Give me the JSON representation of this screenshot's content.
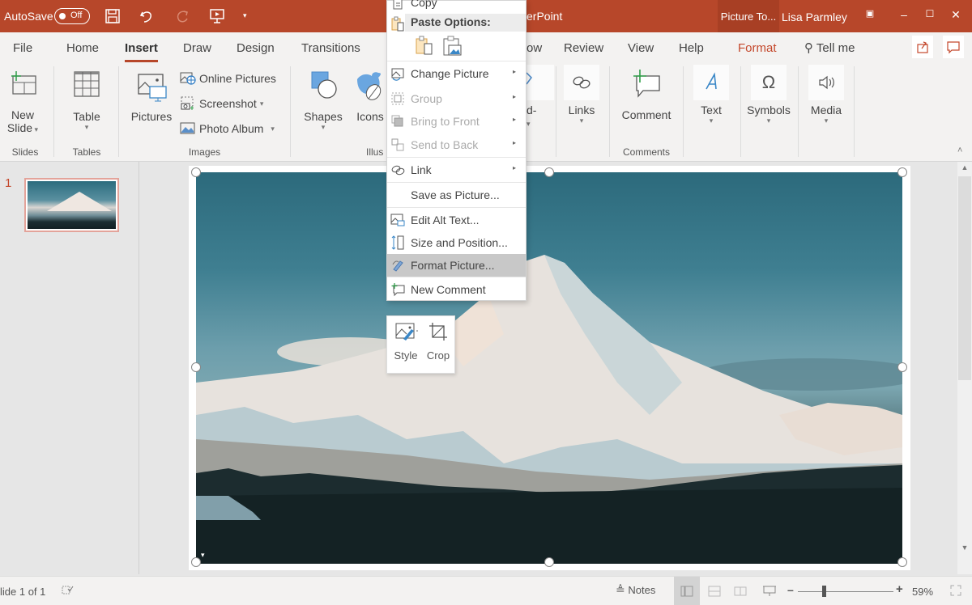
{
  "titlebar": {
    "autosave_label": "AutoSave",
    "autosave_state": "Off",
    "app_title": "erPoint",
    "context_tab_title": "Picture To...",
    "user_name": "Lisa Parmley",
    "qat": [
      "save-icon",
      "undo-icon",
      "redo-icon",
      "start-from-beginning-icon",
      "customize-qat-icon"
    ],
    "window_controls": [
      "ribbon-display-options-icon",
      "minimize-icon",
      "maximize-icon",
      "close-icon"
    ],
    "brand_color": "#b7472a"
  },
  "tabs": [
    {
      "label": "File"
    },
    {
      "label": "Home"
    },
    {
      "label": "Insert",
      "active": true
    },
    {
      "label": "Draw"
    },
    {
      "label": "Design"
    },
    {
      "label": "Transitions"
    },
    {
      "label": "ow"
    },
    {
      "label": "Review"
    },
    {
      "label": "View"
    },
    {
      "label": "Help"
    },
    {
      "label": "Format",
      "contextual": true
    }
  ],
  "tell_me": "Tell me",
  "ribbon": {
    "groups": {
      "slides": {
        "label": "Slides",
        "new_slide": "New",
        "new_slide2": "Slide"
      },
      "tables": {
        "label": "Tables",
        "table": "Table"
      },
      "images": {
        "label": "Images",
        "pictures": "Pictures",
        "online_pictures": "Online Pictures",
        "screenshot": "Screenshot",
        "photo_album": "Photo Album"
      },
      "illustrations": {
        "label": "Illus",
        "shapes": "Shapes",
        "icons": "Icons",
        "addins_partial": "d-"
      },
      "links": {
        "links": "Links"
      },
      "comments": {
        "label": "Comments",
        "comment": "Comment"
      },
      "text": {
        "text": "Text"
      },
      "symbols": {
        "symbols": "Symbols"
      },
      "media": {
        "media": "Media"
      }
    }
  },
  "slides_pane": {
    "slides": [
      {
        "number": "1",
        "selected": true
      }
    ]
  },
  "context_menu": {
    "copy": "Copy",
    "paste_options": "Paste Options:",
    "items": [
      {
        "label": "Change Picture",
        "icon": "change-picture-icon",
        "submenu": true,
        "disabled": false
      },
      {
        "label": "Group",
        "icon": "group-icon",
        "submenu": true,
        "disabled": true
      },
      {
        "label": "Bring to Front",
        "icon": "bring-to-front-icon",
        "submenu": true,
        "disabled": true
      },
      {
        "label": "Send to Back",
        "icon": "send-to-back-icon",
        "submenu": true,
        "disabled": true
      },
      {
        "label": "Link",
        "icon": "link-icon",
        "submenu": true,
        "disabled": false
      },
      {
        "label": "Save as Picture...",
        "icon": "",
        "submenu": false,
        "disabled": false
      },
      {
        "label": "Edit Alt Text...",
        "icon": "alt-text-icon",
        "submenu": false,
        "disabled": false
      },
      {
        "label": "Size and Position...",
        "icon": "size-position-icon",
        "submenu": false,
        "disabled": false
      },
      {
        "label": "Format Picture...",
        "icon": "format-picture-icon",
        "submenu": false,
        "disabled": false,
        "highlighted": true
      },
      {
        "label": "New Comment",
        "icon": "new-comment-icon",
        "submenu": false,
        "disabled": false
      }
    ]
  },
  "mini_toolbar": {
    "style": "Style",
    "crop": "Crop"
  },
  "statusbar": {
    "slide_info": "lide 1 of 1",
    "notes": "Notes",
    "zoom_level": "59%",
    "zoom_fraction": 0.59
  }
}
